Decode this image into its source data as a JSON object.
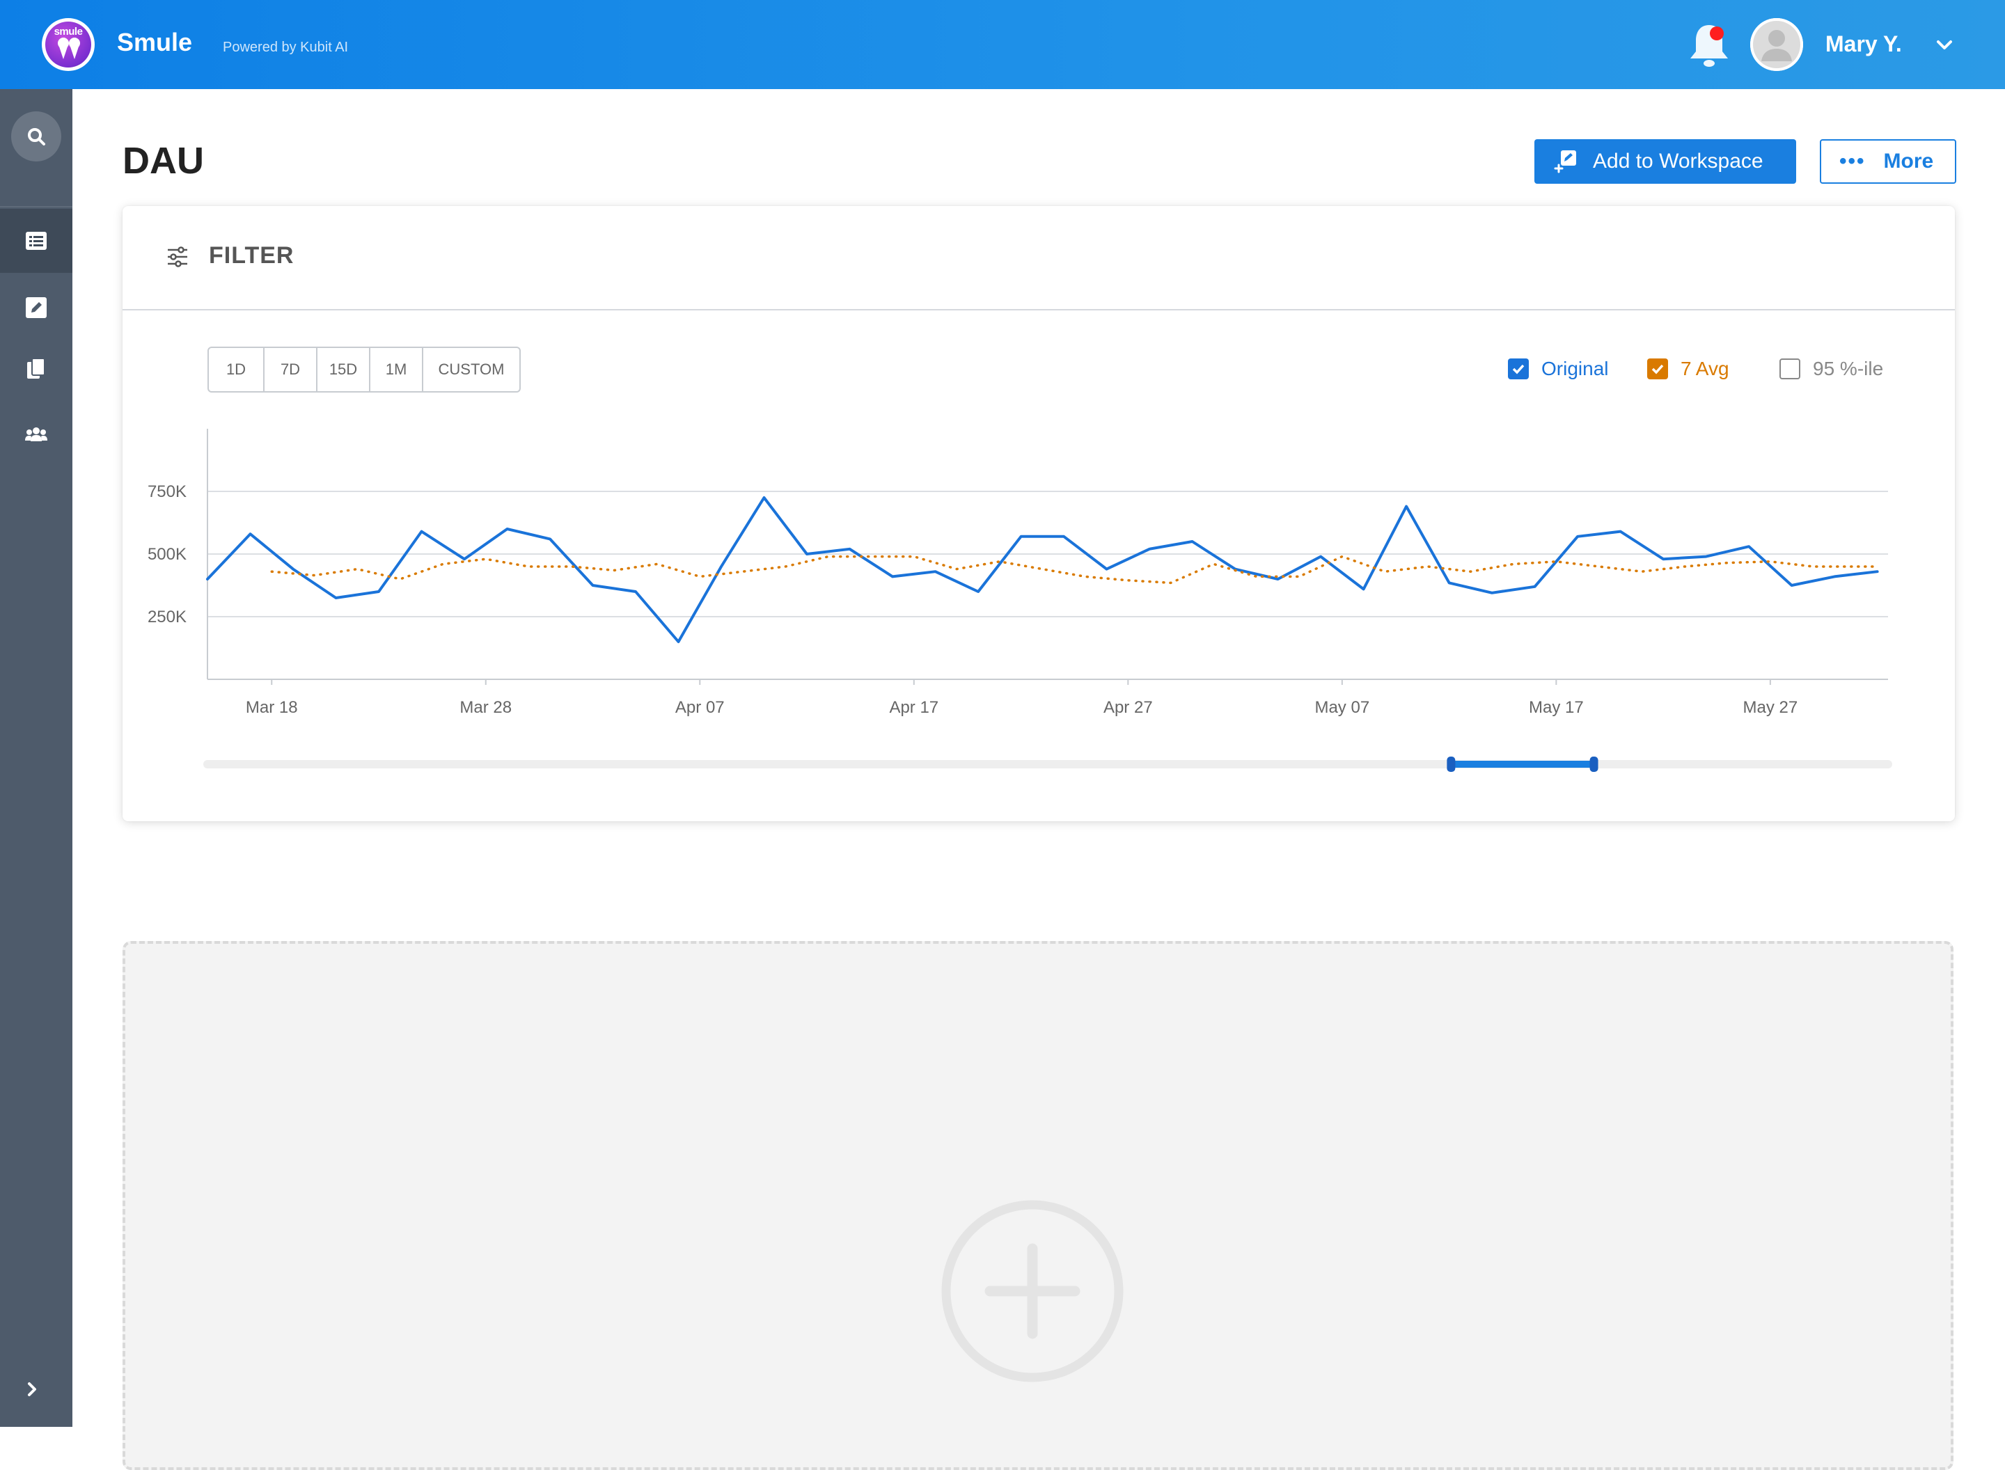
{
  "header": {
    "brand": "Smule",
    "logo_text": "smule",
    "powered_by": "Powered by Kubit AI",
    "user_name": "Mary Y.",
    "notification_dot_color": "#ff1f1f"
  },
  "sidebar": {
    "items": [
      {
        "icon": "search-icon"
      },
      {
        "icon": "list-icon",
        "active": true
      },
      {
        "icon": "edit-icon"
      },
      {
        "icon": "copy-icon"
      },
      {
        "icon": "users-icon"
      }
    ],
    "expand_icon": "chevron-right-icon"
  },
  "page": {
    "title": "DAU",
    "add_button": "Add to Workspace",
    "more_button": "More"
  },
  "filter": {
    "label": "FILTER",
    "ranges": [
      "1D",
      "7D",
      "15D",
      "1M",
      "CUSTOM"
    ]
  },
  "legend": {
    "original": {
      "label": "Original",
      "checked": true,
      "color": "#1a73d9"
    },
    "avg": {
      "label": "7 Avg",
      "checked": true,
      "color": "#d97a00"
    },
    "pct": {
      "label": "95 %-ile",
      "checked": false,
      "color": "#888888"
    }
  },
  "chart_data": {
    "type": "line",
    "title": "DAU",
    "xlabel": "",
    "ylabel": "",
    "ylim": [
      0,
      1000000
    ],
    "yticks": [
      250000,
      500000,
      750000
    ],
    "ytick_labels": [
      "250K",
      "500K",
      "750K"
    ],
    "x_start": "Mar 15",
    "xtick_labels": [
      "Mar 18",
      "Mar 28",
      "Apr 07",
      "Apr 17",
      "Apr 27",
      "May 07",
      "May 17",
      "May 27"
    ],
    "x_day_span": 78.5,
    "grid": true,
    "legend_position": "top-right",
    "series": [
      {
        "name": "Original",
        "color": "#1a73d9",
        "style": "solid",
        "x": [
          "Mar 15",
          "Mar 17",
          "Mar 19",
          "Mar 21",
          "Mar 23",
          "Mar 25",
          "Mar 27",
          "Mar 29",
          "Mar 31",
          "Apr 02",
          "Apr 04",
          "Apr 06",
          "Apr 08",
          "Apr 10",
          "Apr 12",
          "Apr 14",
          "Apr 16",
          "Apr 18",
          "Apr 20",
          "Apr 22",
          "Apr 24",
          "Apr 26",
          "Apr 28",
          "Apr 30",
          "May 02",
          "May 04",
          "May 06",
          "May 08",
          "May 10",
          "May 12",
          "May 14",
          "May 16",
          "May 18",
          "May 20",
          "May 22",
          "May 24",
          "May 26",
          "May 28",
          "May 30",
          "Jun 01"
        ],
        "values": [
          400000,
          580000,
          440000,
          325000,
          350000,
          590000,
          480000,
          600000,
          560000,
          375000,
          350000,
          150000,
          450000,
          725000,
          500000,
          520000,
          410000,
          430000,
          350000,
          570000,
          570000,
          440000,
          520000,
          550000,
          440000,
          400000,
          490000,
          360000,
          690000,
          385000,
          345000,
          370000,
          570000,
          590000,
          480000,
          490000,
          530000,
          375000,
          410000,
          430000
        ]
      },
      {
        "name": "7 Avg",
        "color": "#d97a00",
        "style": "dotted",
        "x": [
          "Mar 18",
          "Mar 20",
          "Mar 22",
          "Mar 24",
          "Mar 26",
          "Mar 28",
          "Mar 30",
          "Apr 01",
          "Apr 03",
          "Apr 05",
          "Apr 07",
          "Apr 09",
          "Apr 11",
          "Apr 13",
          "Apr 15",
          "Apr 17",
          "Apr 19",
          "Apr 21",
          "Apr 23",
          "Apr 25",
          "Apr 27",
          "Apr 29",
          "May 01",
          "May 03",
          "May 05",
          "May 07",
          "May 09",
          "May 11",
          "May 13",
          "May 15",
          "May 17",
          "May 19",
          "May 21",
          "May 23",
          "May 25",
          "May 27",
          "May 29",
          "Jun 01"
        ],
        "values": [
          430000,
          415000,
          440000,
          400000,
          460000,
          480000,
          450000,
          450000,
          435000,
          460000,
          410000,
          430000,
          450000,
          490000,
          490000,
          490000,
          440000,
          470000,
          440000,
          410000,
          395000,
          385000,
          460000,
          410000,
          410000,
          490000,
          430000,
          450000,
          430000,
          460000,
          470000,
          450000,
          430000,
          450000,
          465000,
          470000,
          450000,
          450000
        ]
      }
    ],
    "range_selector": {
      "start_fraction": 0.74,
      "end_fraction": 0.825
    }
  },
  "add_area": {
    "icon": "plus-circle-icon"
  }
}
